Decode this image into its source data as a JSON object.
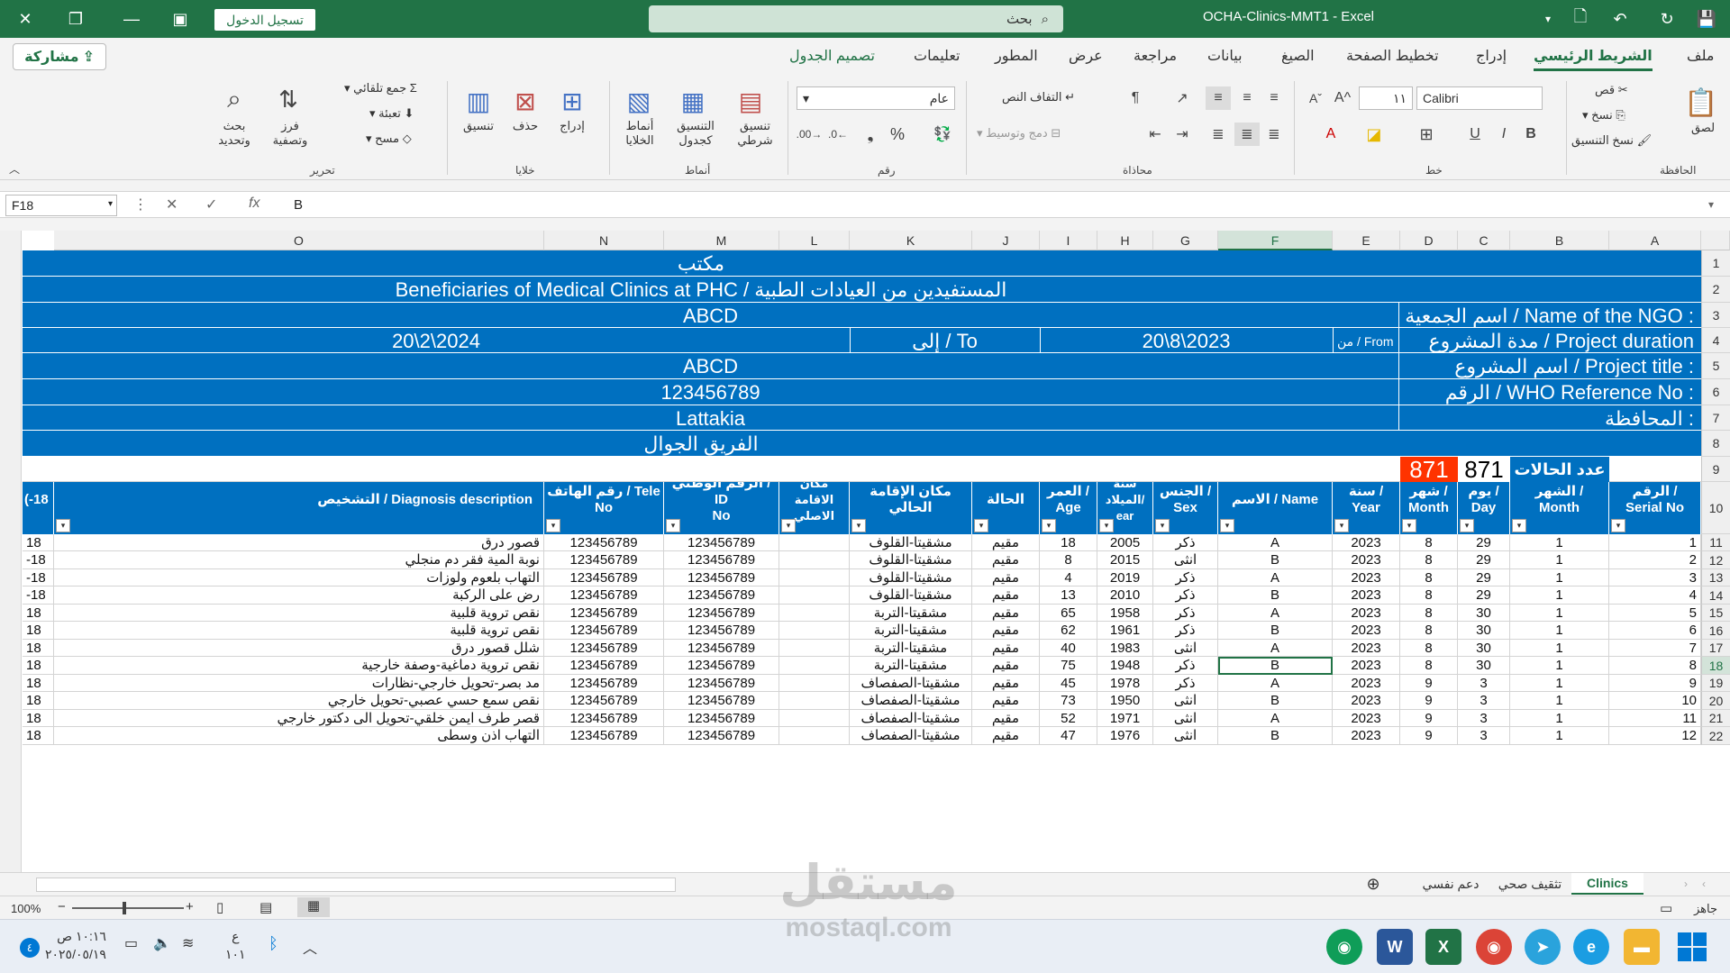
{
  "titlebar": {
    "signin": "تسجيل الدخول",
    "search": "بحث",
    "title": "OCHA-Clinics-MMT1  -  Excel"
  },
  "tabs": {
    "share": "مشاركة",
    "items": [
      "ملف",
      "الشريط الرئيسي",
      "إدراج",
      "تخطيط الصفحة",
      "الصيغ",
      "بيانات",
      "مراجعة",
      "عرض",
      "المطور",
      "تعليمات",
      "تصميم الجدول"
    ]
  },
  "ribbon": {
    "clipboard": {
      "label": "الحافظة",
      "paste": "لصق",
      "cut": "قص",
      "copy": "نسخ",
      "format_painter": "نسخ التنسيق"
    },
    "font": {
      "label": "خط",
      "name": "Calibri",
      "size": "١١"
    },
    "alignment": {
      "label": "محاذاة",
      "wrap": "التفاف النص",
      "merge": "دمج وتوسيط"
    },
    "number": {
      "label": "رقم",
      "format": "عام"
    },
    "styles": {
      "label": "أنماط",
      "conditional": "تنسيق شرطي",
      "as_table": "التنسيق كجدول",
      "cell_styles": "أنماط الخلايا"
    },
    "cells": {
      "label": "خلايا",
      "insert": "إدراج",
      "delete": "حذف",
      "format": "تنسيق"
    },
    "editing": {
      "label": "تحرير",
      "autosum": "جمع تلقائي",
      "fill": "تعبئة",
      "clear": "مسح",
      "sort": "فرز وتصفية",
      "find": "بحث وتحديد"
    }
  },
  "formula": {
    "namebox": "F18",
    "fx": "fx",
    "value": "B"
  },
  "columns": [
    "A",
    "B",
    "C",
    "D",
    "E",
    "F",
    "G",
    "H",
    "I",
    "J",
    "K",
    "L",
    "M",
    "N",
    "O"
  ],
  "header": {
    "row1": "مكتب",
    "row2": "Beneficiaries of Medical Clinics at PHC / المستفيدين من العيادات الطبية",
    "row3_label": "اسم الجمعية / Name of the NGO :",
    "row3_value": "ABCD",
    "row4_label": "مدة المشروع / Project duration",
    "row4_from": "من / From",
    "row4_start": "20\\8\\2023",
    "row4_to": "إلى / To",
    "row4_end": "20\\2\\2024",
    "row5_label": "اسم المشروع / Project title :",
    "row5_value": "ABCD",
    "row6_label": "الرقم / WHO Reference No :",
    "row6_value": "123456789",
    "row7_label": "المحافظة :",
    "row7_value": "Lattakia",
    "row8": "الفريق الجوال",
    "cases_label": "عدد الحالات",
    "cases_count": "871",
    "cases_count2": "871"
  },
  "table": {
    "headers": {
      "A": [
        "الرقم /",
        "Serial No"
      ],
      "B": [
        "الشهر /",
        "Month"
      ],
      "C": [
        "يوم /",
        "Day"
      ],
      "D": [
        "شهر /",
        "Month"
      ],
      "E": [
        "سنة /",
        "Year"
      ],
      "F": [
        "الاسم / Name"
      ],
      "G": [
        "الجنس /",
        "Sex"
      ],
      "H": [
        "سنة",
        "الميلاد/",
        "ear"
      ],
      "I": [
        "العمر /",
        "Age"
      ],
      "J": [
        "الحالة"
      ],
      "K": [
        "مكان الإقامة الحالي"
      ],
      "L": [
        "مكان",
        "الاقامة",
        "الاصلي"
      ],
      "M": [
        "الرقم الوطني / ID",
        "No"
      ],
      "N": [
        "رقم الهاتف / Tele",
        "No"
      ],
      "O": [
        "التشخيص / Diagnosis description"
      ],
      "P": [
        "(-18"
      ]
    },
    "rows": [
      {
        "a": "1",
        "b": "1",
        "c": "29",
        "d": "8",
        "e": "2023",
        "f": "A",
        "g": "ذكر",
        "h": "2005",
        "i": "18",
        "j": "مقيم",
        "k": "مشقيتا-القلوف",
        "l": "",
        "m": "123456789",
        "n": "123456789",
        "o": "قصور درق",
        "p": "18"
      },
      {
        "a": "2",
        "b": "1",
        "c": "29",
        "d": "8",
        "e": "2023",
        "f": "B",
        "g": "انثى",
        "h": "2015",
        "i": "8",
        "j": "مقيم",
        "k": "مشقيتا-القلوف",
        "l": "",
        "m": "123456789",
        "n": "123456789",
        "o": "نوبة المية فقر دم منجلي",
        "p": "-18"
      },
      {
        "a": "3",
        "b": "1",
        "c": "29",
        "d": "8",
        "e": "2023",
        "f": "A",
        "g": "ذكر",
        "h": "2019",
        "i": "4",
        "j": "مقيم",
        "k": "مشقيتا-القلوف",
        "l": "",
        "m": "123456789",
        "n": "123456789",
        "o": "التهاب بلعوم ولوزات",
        "p": "-18"
      },
      {
        "a": "4",
        "b": "1",
        "c": "29",
        "d": "8",
        "e": "2023",
        "f": "B",
        "g": "ذكر",
        "h": "2010",
        "i": "13",
        "j": "مقيم",
        "k": "مشقيتا-القلوف",
        "l": "",
        "m": "123456789",
        "n": "123456789",
        "o": "رض على الركبة",
        "p": "-18"
      },
      {
        "a": "5",
        "b": "1",
        "c": "30",
        "d": "8",
        "e": "2023",
        "f": "A",
        "g": "ذكر",
        "h": "1958",
        "i": "65",
        "j": "مقيم",
        "k": "مشقيتا-التربة",
        "l": "",
        "m": "123456789",
        "n": "123456789",
        "o": "نقص تروية قلبية",
        "p": "18"
      },
      {
        "a": "6",
        "b": "1",
        "c": "30",
        "d": "8",
        "e": "2023",
        "f": "B",
        "g": "ذكر",
        "h": "1961",
        "i": "62",
        "j": "مقيم",
        "k": "مشقيتا-التربة",
        "l": "",
        "m": "123456789",
        "n": "123456789",
        "o": "نقص تروية قلبية",
        "p": "18"
      },
      {
        "a": "7",
        "b": "1",
        "c": "30",
        "d": "8",
        "e": "2023",
        "f": "A",
        "g": "انثى",
        "h": "1983",
        "i": "40",
        "j": "مقيم",
        "k": "مشقيتا-التربة",
        "l": "",
        "m": "123456789",
        "n": "123456789",
        "o": "شلل قصور درق",
        "p": "18"
      },
      {
        "a": "8",
        "b": "1",
        "c": "30",
        "d": "8",
        "e": "2023",
        "f": "B",
        "g": "ذكر",
        "h": "1948",
        "i": "75",
        "j": "مقيم",
        "k": "مشقيتا-التربة",
        "l": "",
        "m": "123456789",
        "n": "123456789",
        "o": "نقص تروية دماغية-وصفة خارجية",
        "p": "18"
      },
      {
        "a": "9",
        "b": "1",
        "c": "3",
        "d": "9",
        "e": "2023",
        "f": "A",
        "g": "ذكر",
        "h": "1978",
        "i": "45",
        "j": "مقيم",
        "k": "مشقيتا-الصفصاف",
        "l": "",
        "m": "123456789",
        "n": "123456789",
        "o": "مد بصر-تحويل خارجي-نظارات",
        "p": "18"
      },
      {
        "a": "10",
        "b": "1",
        "c": "3",
        "d": "9",
        "e": "2023",
        "f": "B",
        "g": "انثى",
        "h": "1950",
        "i": "73",
        "j": "مقيم",
        "k": "مشقيتا-الصفصاف",
        "l": "",
        "m": "123456789",
        "n": "123456789",
        "o": "نقص سمع حسي عصبي-تحويل خارجي",
        "p": "18"
      },
      {
        "a": "11",
        "b": "1",
        "c": "3",
        "d": "9",
        "e": "2023",
        "f": "A",
        "g": "انثى",
        "h": "1971",
        "i": "52",
        "j": "مقيم",
        "k": "مشقيتا-الصفصاف",
        "l": "",
        "m": "123456789",
        "n": "123456789",
        "o": "قصر طرف ايمن خلقي-تحويل الى دكتور خارجي",
        "p": "18"
      },
      {
        "a": "12",
        "b": "1",
        "c": "3",
        "d": "9",
        "e": "2023",
        "f": "B",
        "g": "انثى",
        "h": "1976",
        "i": "47",
        "j": "مقيم",
        "k": "مشقيتا-الصفصاف",
        "l": "",
        "m": "123456789",
        "n": "123456789",
        "o": "التهاب اذن وسطى",
        "p": "18"
      }
    ]
  },
  "sheets": [
    "Clinics",
    "تثقيف صحي",
    "دعم نفسي"
  ],
  "status": {
    "ready": "جاهز",
    "zoom": "100%"
  },
  "taskbar": {
    "time": "١٠:١٦ ص",
    "date": "٢٠٢٥/٠٥/١٩",
    "lang": "ع",
    "lang2": "١٠١"
  },
  "watermark": {
    "text": "مستقل",
    "site": "mostaql.com"
  }
}
